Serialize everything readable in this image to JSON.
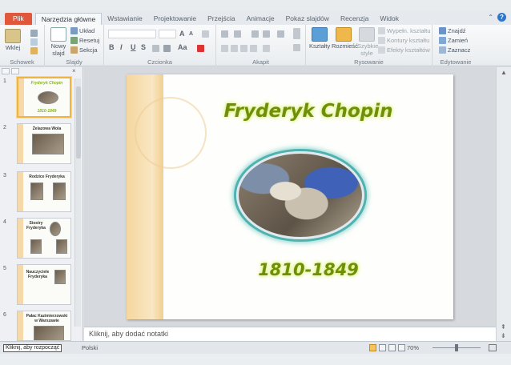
{
  "tabs": [
    {
      "label": "Plik"
    },
    {
      "label": "Narzędzia główne"
    },
    {
      "label": "Wstawianie"
    },
    {
      "label": "Projektowanie"
    },
    {
      "label": "Przejścia"
    },
    {
      "label": "Animacje"
    },
    {
      "label": "Pokaz slajdów"
    },
    {
      "label": "Recenzja"
    },
    {
      "label": "Widok"
    }
  ],
  "ribbon": {
    "clipboard": {
      "paste": "Wklej",
      "label": "Schowek"
    },
    "slides": {
      "new_slide": "Nowy slajd",
      "layout": "Układ",
      "reset": "Resetuj",
      "section": "Sekcja",
      "label": "Slajdy"
    },
    "font": {
      "grow": "A",
      "shrink": "A",
      "bold": "B",
      "italic": "I",
      "underline": "U",
      "strike": "S",
      "aa": "Aa",
      "label": "Czcionka"
    },
    "paragraph": {
      "label": "Akapit"
    },
    "drawing": {
      "shapes": "Kształty",
      "arrange": "Rozmieść",
      "styles": "Szybkie style",
      "fill": "Wypełn. kształtu",
      "outline": "Kontury kształtu",
      "effects": "Efekty kształtów",
      "label": "Rysowanie"
    },
    "editing": {
      "find": "Znajdź",
      "replace": "Zamień",
      "select": "Zaznacz",
      "label": "Edytowanie"
    }
  },
  "slides_panel": {
    "thumbnails": [
      {
        "num": "1",
        "title": "Fryderyk Chopin",
        "sub": "1810-1849"
      },
      {
        "num": "2",
        "title": "Żelazowa Wola"
      },
      {
        "num": "3",
        "title": "Rodzice Fryderyka"
      },
      {
        "num": "4",
        "title": "Siostry Fryderyka"
      },
      {
        "num": "5",
        "title": "Nauczyciele Fryderyka"
      },
      {
        "num": "6",
        "title": "Pałac Kazimierzowski w Warszawie"
      }
    ]
  },
  "slide": {
    "title": "Fryderyk Chopin",
    "years": "1810-1849"
  },
  "notes": {
    "placeholder": "Kliknij, aby dodać notatki"
  },
  "status": {
    "tooltip": "Kliknij, aby rozpocząć",
    "language": "Polski",
    "zoom": "70%"
  },
  "colors": {
    "accent_file": "#e0573c",
    "title_green": "#6f8f0b",
    "selected_thumb": "#f2b43b"
  }
}
